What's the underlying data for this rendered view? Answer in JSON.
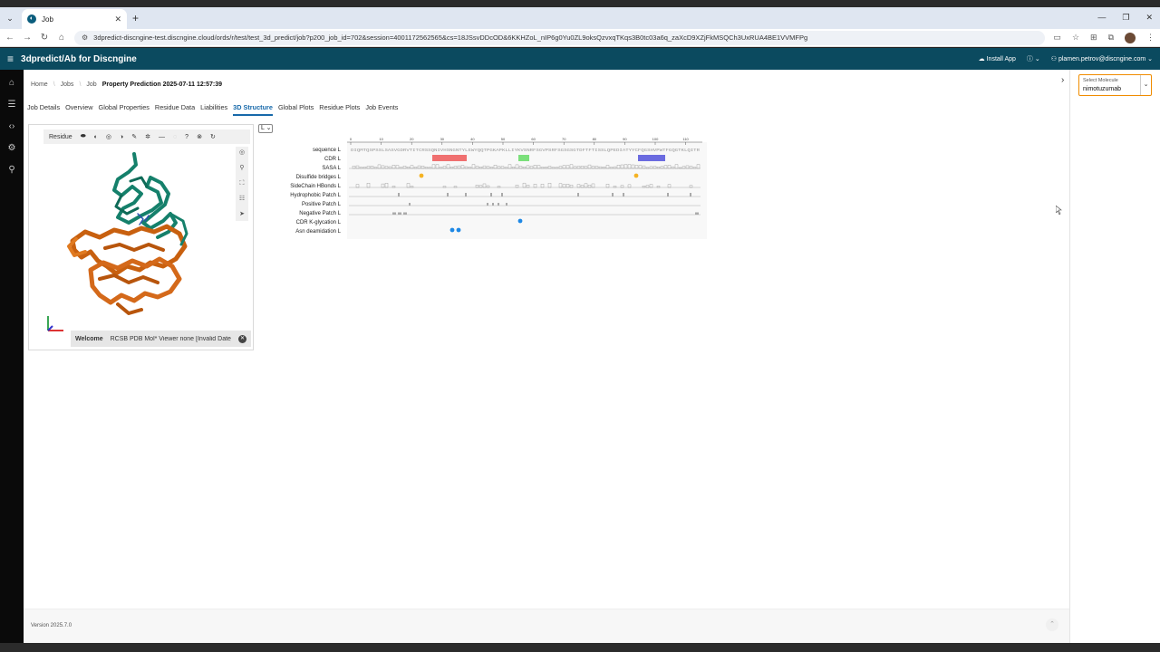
{
  "browser": {
    "tab_title": "Job",
    "url": "3dpredict-discngine-test.discngine.cloud/ords/r/test/test_3d_predict/job?p200_job_id=702&session=4001172562565&cs=18JSsvDDcOD&6KKHZoL_nIP6g0Yu0ZL9oksQzvxqTKqs3B0tc03a6q_zaXcD9XZjFkMSQCh3UxRUA4BE1VVMFPg"
  },
  "app": {
    "title": "3dpredict/Ab for Discngine",
    "install_label": "Install App",
    "user_email": "plamen.petrov@discngine.com"
  },
  "breadcrumb": [
    "Home",
    "Jobs",
    "Job"
  ],
  "page_title": "Property Prediction 2025-07-11 12:57:39",
  "tabs": [
    "Job Details",
    "Overview",
    "Global Properties",
    "Residue Data",
    "Liabilities",
    "3D Structure",
    "Global Plots",
    "Residue Plots",
    "Job Events"
  ],
  "viewer": {
    "mode_label": "Residue",
    "log_title": "Welcome",
    "log_text": "RCSB PDB Mol* Viewer none [Invalid Date]"
  },
  "chain": "L",
  "tracks": {
    "labels": [
      "sequence L",
      "CDR L",
      "SASA L",
      "Disulfide bridges L",
      "SideChain HBonds L",
      "Hydrophobic Patch L",
      "Positive Patch L",
      "Negative Patch L",
      "CDR K-glycation L",
      "Asn deamidation L"
    ],
    "ruler_ticks": [
      "0",
      "10",
      "20",
      "30",
      "40",
      "50",
      "60",
      "70",
      "80",
      "90",
      "100",
      "110"
    ],
    "sequence": "DIQMTQSPSSLSASVGDRVTITCRSSQNIVHSNGNTYLEWYQQTPGKAPKLLIYKVSNRFSGVPSRFSGSGSGTDFTFTISSLQPEDIATYYCFQGSHVPWTFGQGTKLQITR",
    "colors": {
      "cdr1": "#f07070",
      "cdr2": "#7be07b",
      "cdr3": "#6b6be0",
      "disulfide": "#f5b324",
      "glycation": "#1e88e5"
    }
  },
  "right_panel": {
    "select_label": "Select Molecule",
    "select_value": "nimotuzumab"
  },
  "footer": {
    "version": "Version 2025.7.0"
  }
}
